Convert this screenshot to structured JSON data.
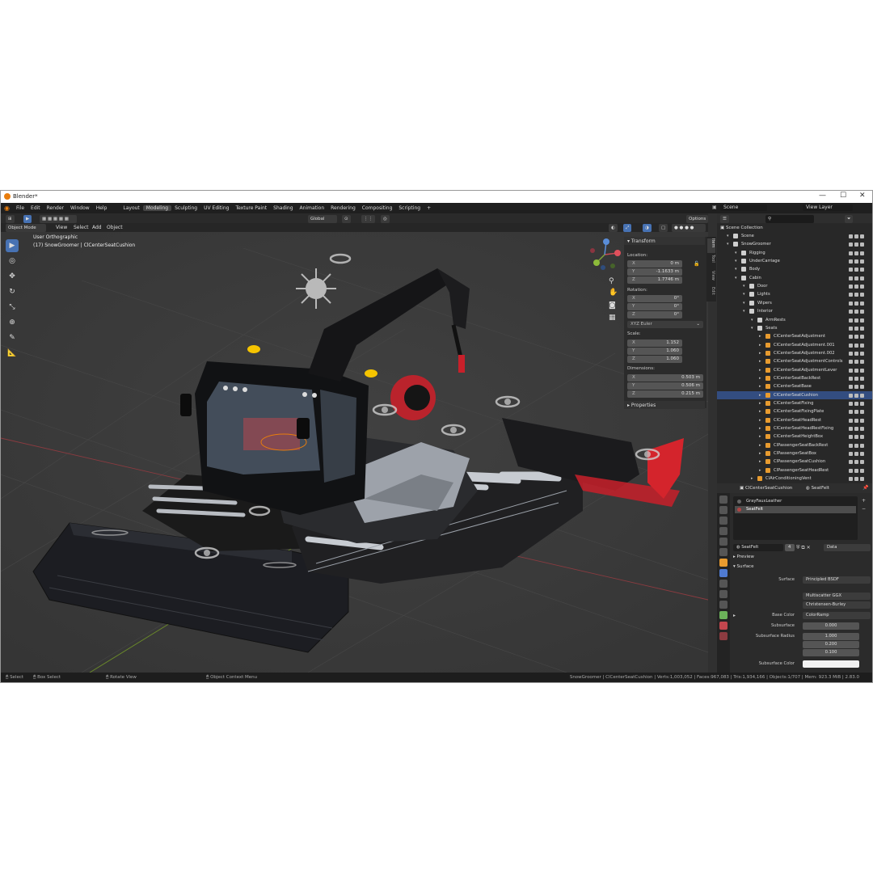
{
  "window": {
    "title": "Blender*",
    "minimize": "—",
    "maximize": "☐",
    "close": "✕"
  },
  "menu": [
    "File",
    "Edit",
    "Render",
    "Window",
    "Help"
  ],
  "workspaces": [
    {
      "label": "Layout",
      "active": false
    },
    {
      "label": "Modeling",
      "active": true
    },
    {
      "label": "Sculpting",
      "active": false
    },
    {
      "label": "UV Editing",
      "active": false
    },
    {
      "label": "Texture Paint",
      "active": false
    },
    {
      "label": "Shading",
      "active": false
    },
    {
      "label": "Animation",
      "active": false
    },
    {
      "label": "Rendering",
      "active": false
    },
    {
      "label": "Compositing",
      "active": false
    },
    {
      "label": "Scripting",
      "active": false
    }
  ],
  "topright": {
    "scene": "Scene",
    "view_layer": "View Layer"
  },
  "header": {
    "mode": "Object Mode",
    "view": "View",
    "select": "Select",
    "add": "Add",
    "object": "Object",
    "orientation": "Global",
    "options": "Options"
  },
  "viewport": {
    "view_name": "User Orthographic",
    "context": "(17) SnowGroomer | ClCenterSeatCushion"
  },
  "npanel": {
    "title": "Transform",
    "location_label": "Location:",
    "location": [
      {
        "axis": "X",
        "value": "0 m"
      },
      {
        "axis": "Y",
        "value": "-1.1633 m"
      },
      {
        "axis": "Z",
        "value": "1.7746 m"
      }
    ],
    "rotation_label": "Rotation:",
    "rotation": [
      {
        "axis": "X",
        "value": "0°"
      },
      {
        "axis": "Y",
        "value": "0°"
      },
      {
        "axis": "Z",
        "value": "0°"
      }
    ],
    "rotation_mode": "XYZ Euler",
    "scale_label": "Scale:",
    "scale": [
      {
        "axis": "X",
        "value": "1.152"
      },
      {
        "axis": "Y",
        "value": "1.060"
      },
      {
        "axis": "Z",
        "value": "1.060"
      }
    ],
    "dimensions_label": "Dimensions:",
    "dimensions": [
      {
        "axis": "X",
        "value": "0.503 m"
      },
      {
        "axis": "Y",
        "value": "0.506 m"
      },
      {
        "axis": "Z",
        "value": "0.215 m"
      }
    ],
    "properties": "Properties"
  },
  "sidetabs": [
    "Item",
    "Tool",
    "View",
    "Edit"
  ],
  "outliner": {
    "title": "Scene Collection",
    "rows": [
      {
        "label": "Scene",
        "indent": 0,
        "kind": "coll",
        "sel": false
      },
      {
        "label": "SnowGroomer",
        "indent": 0,
        "kind": "coll",
        "sel": false
      },
      {
        "label": "Rigging",
        "indent": 1,
        "kind": "coll",
        "sel": false
      },
      {
        "label": "UnderCarriage",
        "indent": 1,
        "kind": "coll",
        "sel": false
      },
      {
        "label": "Body",
        "indent": 1,
        "kind": "coll",
        "sel": false
      },
      {
        "label": "Cabin",
        "indent": 1,
        "kind": "coll",
        "sel": false
      },
      {
        "label": "Door",
        "indent": 2,
        "kind": "coll",
        "sel": false
      },
      {
        "label": "Lights",
        "indent": 2,
        "kind": "coll",
        "sel": false
      },
      {
        "label": "Wipers",
        "indent": 2,
        "kind": "coll",
        "sel": false
      },
      {
        "label": "Interior",
        "indent": 2,
        "kind": "coll",
        "sel": false
      },
      {
        "label": "ArmRests",
        "indent": 3,
        "kind": "coll",
        "sel": false
      },
      {
        "label": "Seats",
        "indent": 3,
        "kind": "coll",
        "sel": false
      },
      {
        "label": "ClCenterSeatAdjustment",
        "indent": 4,
        "kind": "obj",
        "sel": false
      },
      {
        "label": "ClCenterSeatAdjustment.001",
        "indent": 4,
        "kind": "obj",
        "sel": false
      },
      {
        "label": "ClCenterSeatAdjustment.002",
        "indent": 4,
        "kind": "obj",
        "sel": false
      },
      {
        "label": "ClCenterSeatAdjustmentControls",
        "indent": 4,
        "kind": "obj",
        "sel": false
      },
      {
        "label": "ClCenterSeatAdjustmentLever",
        "indent": 4,
        "kind": "obj",
        "sel": false
      },
      {
        "label": "ClCenterSeatBackRest",
        "indent": 4,
        "kind": "obj",
        "sel": false
      },
      {
        "label": "ClCenterSeatBase",
        "indent": 4,
        "kind": "obj",
        "sel": false
      },
      {
        "label": "ClCenterSeatCushion",
        "indent": 4,
        "kind": "obj",
        "sel": true
      },
      {
        "label": "ClCenterSeatFixing",
        "indent": 4,
        "kind": "obj",
        "sel": false
      },
      {
        "label": "ClCenterSeatFixingPlate",
        "indent": 4,
        "kind": "obj",
        "sel": false
      },
      {
        "label": "ClCenterSeatHeadRest",
        "indent": 4,
        "kind": "obj",
        "sel": false
      },
      {
        "label": "ClCenterSeatHeadRestFixing",
        "indent": 4,
        "kind": "obj",
        "sel": false
      },
      {
        "label": "ClCenterSeatHeightBox",
        "indent": 4,
        "kind": "obj",
        "sel": false
      },
      {
        "label": "ClPassengerSeatBackRest",
        "indent": 4,
        "kind": "obj",
        "sel": false
      },
      {
        "label": "ClPassengerSeatBox",
        "indent": 4,
        "kind": "obj",
        "sel": false
      },
      {
        "label": "ClPassengerSeatCushion",
        "indent": 4,
        "kind": "obj",
        "sel": false
      },
      {
        "label": "ClPassengerSeatHeadRest",
        "indent": 4,
        "kind": "obj",
        "sel": false
      },
      {
        "label": "ClAirConditioningVent",
        "indent": 3,
        "kind": "obj",
        "sel": false
      }
    ]
  },
  "props": {
    "object": "ClCenterSeatCushion",
    "material": "SeatFelt",
    "slots": [
      {
        "label": "GrayFauxLeather",
        "sel": false
      },
      {
        "label": "SeatFelt",
        "sel": true
      }
    ],
    "mat_field": "SeatFelt",
    "mat_users": "4",
    "link": "Data",
    "preview": "Preview",
    "surface_panel": "Surface",
    "surface_label": "Surface",
    "surface_value": "Principled BSDF",
    "distribution": "Multiscatter GGX",
    "subsurface_method": "Christensen-Burley",
    "base_color_label": "Base Color",
    "base_color_value": "ColorRamp",
    "subsurface_label": "Subsurface",
    "subsurface_value": "0.000",
    "radius_label": "Subsurface Radius",
    "radius": [
      "1.000",
      "0.200",
      "0.100"
    ],
    "sscolor_label": "Subsurface Color"
  },
  "status": {
    "select": "Select",
    "box_select": "Box Select",
    "rotate": "Rotate View",
    "context_menu": "Object Context Menu",
    "stats": "SnowGroomer | ClCenterSeatCushion | Verts:1,003,052 | Faces:967,083 | Tris:1,934,166 | Objects:1/707 | Mem: 923.3 MiB | 2.83.0"
  },
  "colors": {
    "accent": "#4772b3",
    "selection": "#334d80",
    "object_orange": "#e89b2f"
  }
}
